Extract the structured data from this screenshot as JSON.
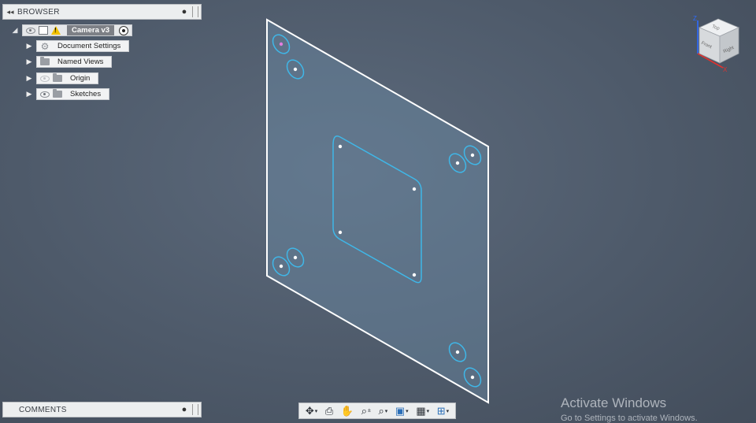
{
  "browser": {
    "title": "BROWSER",
    "collapse_icon": "double-chevron-left-icon",
    "root": {
      "label": "Camera v3",
      "warning": "!"
    },
    "items": [
      {
        "label": "Document Settings",
        "icon": "gear-icon"
      },
      {
        "label": "Named Views",
        "icon": "folder-icon"
      },
      {
        "label": "Origin",
        "icon": "folder-icon"
      },
      {
        "label": "Sketches",
        "icon": "folder-icon"
      }
    ]
  },
  "comments": {
    "title": "COMMENTS"
  },
  "viewcube": {
    "top": "Top",
    "front": "Front",
    "right": "Right",
    "axis_z": "Z",
    "axis_x": "X"
  },
  "toolbar": {
    "items": [
      "orbit-icon",
      "look-at-icon",
      "pan-icon",
      "zoom-icon",
      "fit-icon",
      "display-settings-icon",
      "grid-icon",
      "viewports-icon"
    ]
  },
  "watermark": {
    "line1": "Activate Windows",
    "line2": "Go to Settings to activate Windows."
  },
  "colors": {
    "sketch": "#3fb7e8",
    "plate_edge": "#ffffff",
    "background": "#4e5a6a"
  }
}
